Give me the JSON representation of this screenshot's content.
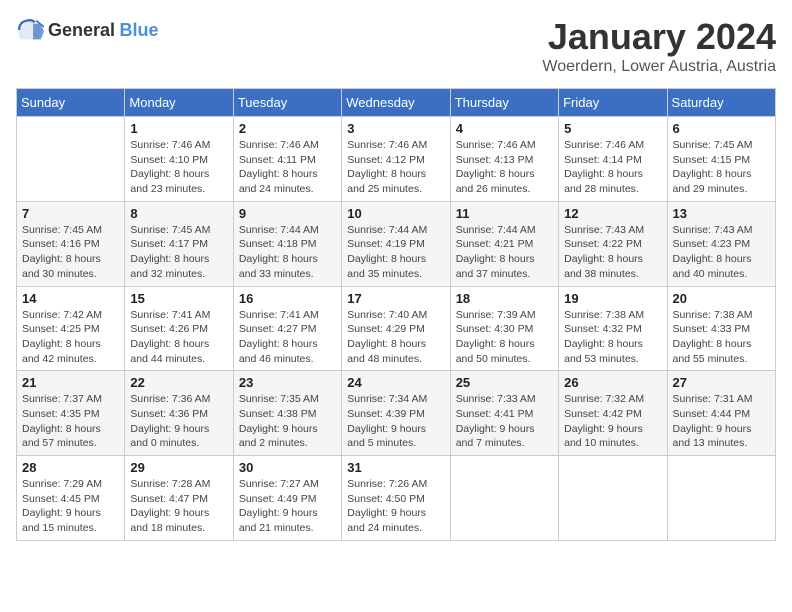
{
  "header": {
    "logo_general": "General",
    "logo_blue": "Blue",
    "month_title": "January 2024",
    "location": "Woerdern, Lower Austria, Austria"
  },
  "days_of_week": [
    "Sunday",
    "Monday",
    "Tuesday",
    "Wednesday",
    "Thursday",
    "Friday",
    "Saturday"
  ],
  "weeks": [
    [
      {
        "day": "",
        "sunrise": "",
        "sunset": "",
        "daylight": ""
      },
      {
        "day": "1",
        "sunrise": "Sunrise: 7:46 AM",
        "sunset": "Sunset: 4:10 PM",
        "daylight": "Daylight: 8 hours and 23 minutes."
      },
      {
        "day": "2",
        "sunrise": "Sunrise: 7:46 AM",
        "sunset": "Sunset: 4:11 PM",
        "daylight": "Daylight: 8 hours and 24 minutes."
      },
      {
        "day": "3",
        "sunrise": "Sunrise: 7:46 AM",
        "sunset": "Sunset: 4:12 PM",
        "daylight": "Daylight: 8 hours and 25 minutes."
      },
      {
        "day": "4",
        "sunrise": "Sunrise: 7:46 AM",
        "sunset": "Sunset: 4:13 PM",
        "daylight": "Daylight: 8 hours and 26 minutes."
      },
      {
        "day": "5",
        "sunrise": "Sunrise: 7:46 AM",
        "sunset": "Sunset: 4:14 PM",
        "daylight": "Daylight: 8 hours and 28 minutes."
      },
      {
        "day": "6",
        "sunrise": "Sunrise: 7:45 AM",
        "sunset": "Sunset: 4:15 PM",
        "daylight": "Daylight: 8 hours and 29 minutes."
      }
    ],
    [
      {
        "day": "7",
        "sunrise": "Sunrise: 7:45 AM",
        "sunset": "Sunset: 4:16 PM",
        "daylight": "Daylight: 8 hours and 30 minutes."
      },
      {
        "day": "8",
        "sunrise": "Sunrise: 7:45 AM",
        "sunset": "Sunset: 4:17 PM",
        "daylight": "Daylight: 8 hours and 32 minutes."
      },
      {
        "day": "9",
        "sunrise": "Sunrise: 7:44 AM",
        "sunset": "Sunset: 4:18 PM",
        "daylight": "Daylight: 8 hours and 33 minutes."
      },
      {
        "day": "10",
        "sunrise": "Sunrise: 7:44 AM",
        "sunset": "Sunset: 4:19 PM",
        "daylight": "Daylight: 8 hours and 35 minutes."
      },
      {
        "day": "11",
        "sunrise": "Sunrise: 7:44 AM",
        "sunset": "Sunset: 4:21 PM",
        "daylight": "Daylight: 8 hours and 37 minutes."
      },
      {
        "day": "12",
        "sunrise": "Sunrise: 7:43 AM",
        "sunset": "Sunset: 4:22 PM",
        "daylight": "Daylight: 8 hours and 38 minutes."
      },
      {
        "day": "13",
        "sunrise": "Sunrise: 7:43 AM",
        "sunset": "Sunset: 4:23 PM",
        "daylight": "Daylight: 8 hours and 40 minutes."
      }
    ],
    [
      {
        "day": "14",
        "sunrise": "Sunrise: 7:42 AM",
        "sunset": "Sunset: 4:25 PM",
        "daylight": "Daylight: 8 hours and 42 minutes."
      },
      {
        "day": "15",
        "sunrise": "Sunrise: 7:41 AM",
        "sunset": "Sunset: 4:26 PM",
        "daylight": "Daylight: 8 hours and 44 minutes."
      },
      {
        "day": "16",
        "sunrise": "Sunrise: 7:41 AM",
        "sunset": "Sunset: 4:27 PM",
        "daylight": "Daylight: 8 hours and 46 minutes."
      },
      {
        "day": "17",
        "sunrise": "Sunrise: 7:40 AM",
        "sunset": "Sunset: 4:29 PM",
        "daylight": "Daylight: 8 hours and 48 minutes."
      },
      {
        "day": "18",
        "sunrise": "Sunrise: 7:39 AM",
        "sunset": "Sunset: 4:30 PM",
        "daylight": "Daylight: 8 hours and 50 minutes."
      },
      {
        "day": "19",
        "sunrise": "Sunrise: 7:38 AM",
        "sunset": "Sunset: 4:32 PM",
        "daylight": "Daylight: 8 hours and 53 minutes."
      },
      {
        "day": "20",
        "sunrise": "Sunrise: 7:38 AM",
        "sunset": "Sunset: 4:33 PM",
        "daylight": "Daylight: 8 hours and 55 minutes."
      }
    ],
    [
      {
        "day": "21",
        "sunrise": "Sunrise: 7:37 AM",
        "sunset": "Sunset: 4:35 PM",
        "daylight": "Daylight: 8 hours and 57 minutes."
      },
      {
        "day": "22",
        "sunrise": "Sunrise: 7:36 AM",
        "sunset": "Sunset: 4:36 PM",
        "daylight": "Daylight: 9 hours and 0 minutes."
      },
      {
        "day": "23",
        "sunrise": "Sunrise: 7:35 AM",
        "sunset": "Sunset: 4:38 PM",
        "daylight": "Daylight: 9 hours and 2 minutes."
      },
      {
        "day": "24",
        "sunrise": "Sunrise: 7:34 AM",
        "sunset": "Sunset: 4:39 PM",
        "daylight": "Daylight: 9 hours and 5 minutes."
      },
      {
        "day": "25",
        "sunrise": "Sunrise: 7:33 AM",
        "sunset": "Sunset: 4:41 PM",
        "daylight": "Daylight: 9 hours and 7 minutes."
      },
      {
        "day": "26",
        "sunrise": "Sunrise: 7:32 AM",
        "sunset": "Sunset: 4:42 PM",
        "daylight": "Daylight: 9 hours and 10 minutes."
      },
      {
        "day": "27",
        "sunrise": "Sunrise: 7:31 AM",
        "sunset": "Sunset: 4:44 PM",
        "daylight": "Daylight: 9 hours and 13 minutes."
      }
    ],
    [
      {
        "day": "28",
        "sunrise": "Sunrise: 7:29 AM",
        "sunset": "Sunset: 4:45 PM",
        "daylight": "Daylight: 9 hours and 15 minutes."
      },
      {
        "day": "29",
        "sunrise": "Sunrise: 7:28 AM",
        "sunset": "Sunset: 4:47 PM",
        "daylight": "Daylight: 9 hours and 18 minutes."
      },
      {
        "day": "30",
        "sunrise": "Sunrise: 7:27 AM",
        "sunset": "Sunset: 4:49 PM",
        "daylight": "Daylight: 9 hours and 21 minutes."
      },
      {
        "day": "31",
        "sunrise": "Sunrise: 7:26 AM",
        "sunset": "Sunset: 4:50 PM",
        "daylight": "Daylight: 9 hours and 24 minutes."
      },
      {
        "day": "",
        "sunrise": "",
        "sunset": "",
        "daylight": ""
      },
      {
        "day": "",
        "sunrise": "",
        "sunset": "",
        "daylight": ""
      },
      {
        "day": "",
        "sunrise": "",
        "sunset": "",
        "daylight": ""
      }
    ]
  ]
}
